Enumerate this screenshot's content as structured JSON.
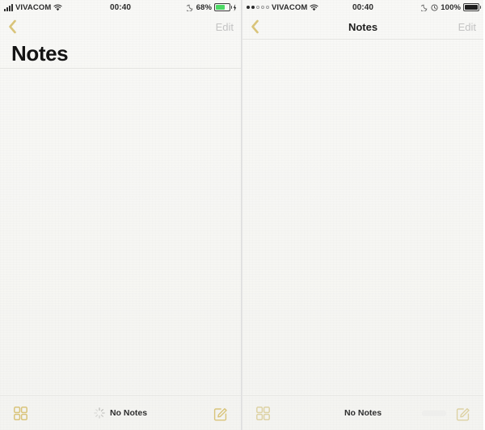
{
  "app": {
    "name": "Notes",
    "accent_gold": "#d9c47a",
    "accent_gold_faded": "#ddd2a4",
    "disabled_gray": "#c3c3c3",
    "text_dark": "#1f1f1f",
    "paper_bg": "#f7f7f5",
    "battery_green": "#4cd964"
  },
  "panels": [
    {
      "id": "left",
      "status_bar": {
        "signal_type": "bars",
        "signal_bars_total": 4,
        "signal_bars_active": 4,
        "carrier": "VIVACOM",
        "wifi_icon": "wifi-icon",
        "time": "00:40",
        "dnd_icon": "moon-icon",
        "battery_percent": "68%",
        "battery_level": 68,
        "battery_charging": true,
        "charging_icon": "bolt-icon",
        "battery_color": "#4cd964"
      },
      "nav_bar": {
        "back_icon": "chevron-left-icon",
        "title": "",
        "edit_label": "Edit",
        "edit_enabled": false
      },
      "large_title": "Notes",
      "show_large_title": true,
      "toolbar": {
        "grid_icon": "grid-icon",
        "compose_icon": "compose-icon",
        "status_text": "No Notes",
        "show_spinner": true,
        "spinner_icon": "activity-spinner-icon"
      }
    },
    {
      "id": "right",
      "status_bar": {
        "signal_type": "dots",
        "signal_dots_total": 5,
        "signal_dots_active": 2,
        "carrier": "VIVACOM",
        "wifi_icon": "wifi-icon",
        "time": "00:40",
        "dnd_icon": "moon-icon",
        "alarm_icon": "alarm-icon",
        "battery_percent": "100%",
        "battery_level": 100,
        "battery_charging": false,
        "battery_color": "#1f1f1f"
      },
      "nav_bar": {
        "back_icon": "chevron-left-icon",
        "title": "Notes",
        "edit_label": "Edit",
        "edit_enabled": false
      },
      "large_title": "",
      "show_large_title": false,
      "toolbar": {
        "grid_icon": "grid-icon",
        "compose_icon": "compose-icon",
        "status_text": "No Notes",
        "show_spinner": false
      }
    }
  ]
}
